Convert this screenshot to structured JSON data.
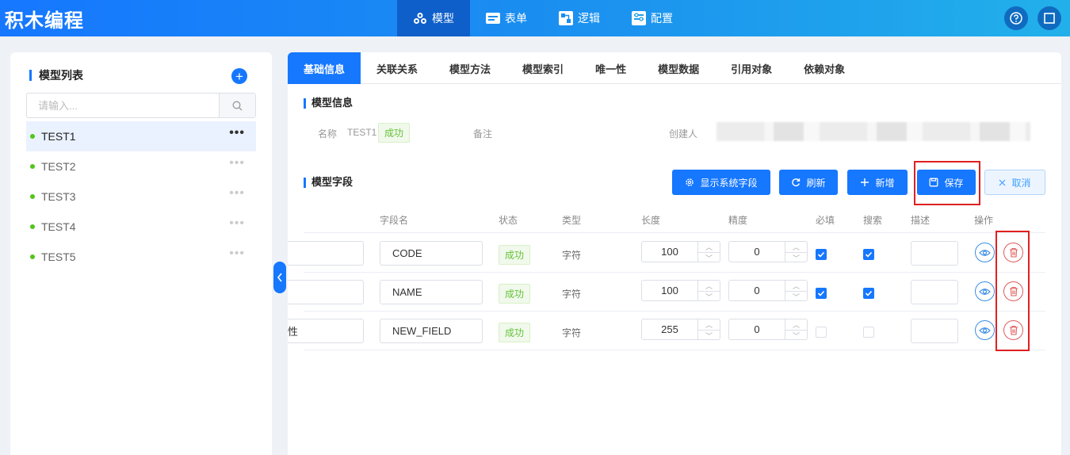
{
  "app": {
    "title": "积木编程"
  },
  "nav": [
    {
      "label": "模型",
      "icon": "cubes-icon"
    },
    {
      "label": "表单",
      "icon": "form-icon"
    },
    {
      "label": "逻辑",
      "icon": "logic-icon"
    },
    {
      "label": "配置",
      "icon": "config-icon"
    }
  ],
  "sidebar": {
    "title": "模型列表",
    "search_placeholder": "请输入...",
    "models": [
      "TEST1",
      "TEST2",
      "TEST3",
      "TEST4",
      "TEST5"
    ],
    "more": "•••"
  },
  "tabs": [
    "基础信息",
    "关联关系",
    "模型方法",
    "模型索引",
    "唯一性",
    "模型数据",
    "引用对象",
    "依赖对象"
  ],
  "model_info": {
    "section_title": "模型信息",
    "name_label": "名称",
    "name_value": "TEST1",
    "status": "成功",
    "remark_label": "备注",
    "creator_label": "创建人"
  },
  "fields": {
    "section_title": "模型字段",
    "buttons": {
      "show_system": "显示系统字段",
      "refresh": "刷新",
      "add": "新增",
      "save": "保存",
      "cancel": "取消"
    },
    "columns": [
      "字段名",
      "状态",
      "类型",
      "长度",
      "精度",
      "必填",
      "搜索",
      "描述",
      "操作"
    ],
    "rows": [
      {
        "label_partial": "",
        "field_name": "CODE",
        "status": "成功",
        "type": "字符",
        "length": "100",
        "precision": "0",
        "required": true,
        "search": true
      },
      {
        "label_partial": "",
        "field_name": "NAME",
        "status": "成功",
        "type": "字符",
        "length": "100",
        "precision": "0",
        "required": true,
        "search": true
      },
      {
        "label_partial": "性",
        "field_name": "NEW_FIELD",
        "status": "成功",
        "type": "字符",
        "length": "255",
        "precision": "0",
        "required": false,
        "search": false
      }
    ]
  },
  "colors": {
    "primary": "#1677ff",
    "success": "#67c23a",
    "danger": "#e02020"
  }
}
